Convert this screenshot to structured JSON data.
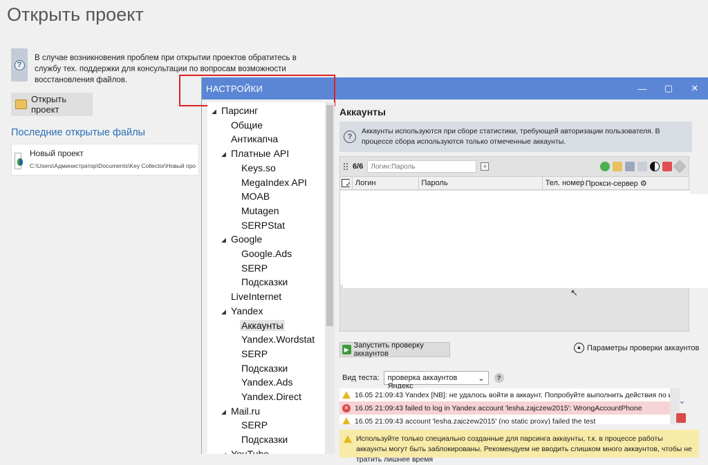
{
  "background": {
    "title": "Открыть проект",
    "info_text": "В случае возникновения проблем при открытии проектов обратитесь в службу тех. поддержки для консультации по вопросам возможности восстановления файлов.",
    "open_button": "Открыть проект",
    "recent_title": "Последние открытые файлы",
    "recent_item_name": "Новый проект",
    "recent_item_path": "C:\\Users\\Администратор\\Documents\\Key Collector\\Новый проект.kcdb"
  },
  "dialog": {
    "title": "НАСТРОЙКИ",
    "controls": {
      "minimize": "—",
      "maximize": "▢",
      "close": "✕"
    }
  },
  "tree": [
    {
      "label": "Парсинг",
      "level": 0,
      "expanded": true
    },
    {
      "label": "Общие",
      "level": 1
    },
    {
      "label": "Антикапча",
      "level": 1
    },
    {
      "label": "Платные API",
      "level": 1,
      "expanded": true
    },
    {
      "label": "Keys.so",
      "level": 2
    },
    {
      "label": "MegaIndex API",
      "level": 2
    },
    {
      "label": "MOAB",
      "level": 2
    },
    {
      "label": "Mutagen",
      "level": 2
    },
    {
      "label": "SERPStat",
      "level": 2
    },
    {
      "label": "Google",
      "level": 1,
      "expanded": true
    },
    {
      "label": "Google.Ads",
      "level": 2
    },
    {
      "label": "SERP",
      "level": 2
    },
    {
      "label": "Подсказки",
      "level": 2
    },
    {
      "label": "LiveInternet",
      "level": 1
    },
    {
      "label": "Yandex",
      "level": 1,
      "expanded": true
    },
    {
      "label": "Аккаунты",
      "level": 2,
      "selected": true
    },
    {
      "label": "Yandex.Wordstat",
      "level": 2
    },
    {
      "label": "SERP",
      "level": 2
    },
    {
      "label": "Подсказки",
      "level": 2
    },
    {
      "label": "Yandex.Ads",
      "level": 2
    },
    {
      "label": "Yandex.Direct",
      "level": 2
    },
    {
      "label": "Mail.ru",
      "level": 1,
      "expanded": true
    },
    {
      "label": "SERP",
      "level": 2
    },
    {
      "label": "Подсказки",
      "level": 2
    },
    {
      "label": "YouTube",
      "level": 1,
      "expanded": true
    }
  ],
  "accounts": {
    "title": "Аккаунты",
    "info": "Аккаунты используются при сборе статистики, требующей авторизации пользователя. В процессе сбора используются только отмеченные аккаунты.",
    "count": "6/6",
    "login_placeholder": "Логин:Пароль",
    "columns": {
      "login": "Логин",
      "password": "Пароль",
      "phone": "Тел. номер",
      "proxy": "Прокси-сервер"
    },
    "run_button": "Запустить проверку аккаунтов",
    "params_label": "Параметры проверки аккаунтов",
    "test_label": "Вид теста:",
    "test_value": "проверка аккаунтов Яндекс",
    "log": [
      {
        "type": "warn",
        "text": "16.05 21:09:43  Yandex [NB]: не удалось войти в аккаунт. Попробуйте выполнить действия по инстру"
      },
      {
        "type": "err",
        "text": "16.05 21:09:43  failed to log in Yandex account 'lesha.zajczew2015': WrongAccountPhone"
      },
      {
        "type": "warn",
        "text": "16.05 21:09:43  account 'lesha.zajczew2015' (no static proxy) failed the test"
      }
    ],
    "warning": "Используйте только специально созданные для парсинга аккаунты, т.к. в процессе работы аккаунты могут быть заблокированы. Рекомендуем не вводить слишком много аккаунтов, чтобы не тратить лишнее время"
  },
  "colors": {
    "titlebar": "#5b86d5",
    "highlight_box": "#e02020",
    "link": "#2a6fb5"
  }
}
